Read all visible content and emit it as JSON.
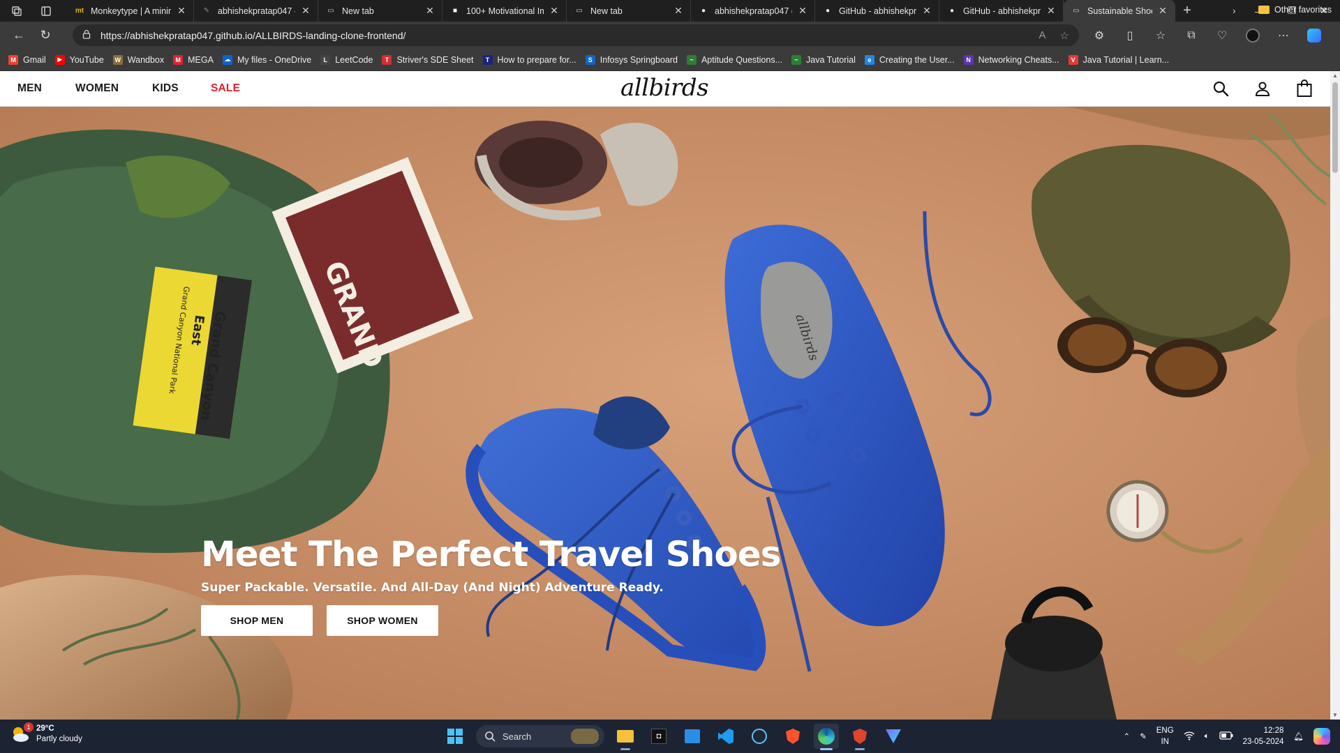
{
  "browser": {
    "tabs": [
      {
        "title": "Monkeytype | A minim",
        "favicon": "mt",
        "color": "#e2b714",
        "active": false
      },
      {
        "title": "abhishekpratap047 - ",
        "favicon": "leaf",
        "color": "#8a8a8a",
        "active": false
      },
      {
        "title": "New tab",
        "favicon": "page",
        "color": "#cccccc",
        "active": false
      },
      {
        "title": "100+ Motivational Im",
        "favicon": "square",
        "color": "#ffffff",
        "active": false
      },
      {
        "title": "New tab",
        "favicon": "page",
        "color": "#cccccc",
        "active": false
      },
      {
        "title": "abhishekpratap047 (A",
        "favicon": "github",
        "color": "#ffffff",
        "active": false
      },
      {
        "title": "GitHub - abhishekpra",
        "favicon": "github",
        "color": "#ffffff",
        "active": false
      },
      {
        "title": "GitHub - abhishekpra",
        "favicon": "github",
        "color": "#ffffff",
        "active": false
      },
      {
        "title": "Sustainable Shoes &",
        "favicon": "page",
        "color": "#cccccc",
        "active": true
      }
    ],
    "address": "https://abhishekpratap047.github.io/ALLBIRDS-landing-clone-frontend/",
    "bookmarks": [
      {
        "label": "Gmail",
        "icon": "gmail-icon",
        "color": "#ea4335",
        "glyph": "M"
      },
      {
        "label": "YouTube",
        "icon": "youtube-icon",
        "color": "#ff0000",
        "glyph": "▶"
      },
      {
        "label": "Wandbox",
        "icon": "wandbox-icon",
        "color": "#8a6d3b",
        "glyph": "W"
      },
      {
        "label": "MEGA",
        "icon": "mega-icon",
        "color": "#d9272e",
        "glyph": "M"
      },
      {
        "label": "My files - OneDrive",
        "icon": "onedrive-icon",
        "color": "#0a64d2",
        "glyph": "☁"
      },
      {
        "label": "LeetCode",
        "icon": "leetcode-icon",
        "color": "#444444",
        "glyph": "L"
      },
      {
        "label": "Striver's SDE Sheet",
        "icon": "tuf-icon",
        "color": "#d32f2f",
        "glyph": "T"
      },
      {
        "label": "How to prepare for...",
        "icon": "tnp-icon",
        "color": "#1a237e",
        "glyph": "T"
      },
      {
        "label": "Infosys Springboard",
        "icon": "infosys-icon",
        "color": "#1565c0",
        "glyph": "S"
      },
      {
        "label": "Aptitude Questions...",
        "icon": "aptitude-icon",
        "color": "#2e7d32",
        "glyph": "~"
      },
      {
        "label": "Java Tutorial",
        "icon": "java-icon",
        "color": "#2e7d32",
        "glyph": "~"
      },
      {
        "label": "Creating the User...",
        "icon": "edu-icon",
        "color": "#1e88e5",
        "glyph": "e"
      },
      {
        "label": "Networking Cheats...",
        "icon": "network-icon",
        "color": "#5e35b1",
        "glyph": "N"
      },
      {
        "label": "Java Tutorial | Learn...",
        "icon": "vk-icon",
        "color": "#e53935",
        "glyph": "V"
      }
    ],
    "other_favorites": "Other favorites"
  },
  "site": {
    "nav": {
      "men": "MEN",
      "women": "WOMEN",
      "kids": "KIDS",
      "sale": "SALE"
    },
    "logo": "allbirds",
    "hero": {
      "title": "Meet The Perfect Travel Shoes",
      "subtitle": "Super Packable. Versatile. And All-Day (And Night) Adventure Ready.",
      "shop_men": "SHOP MEN",
      "shop_women": "SHOP WOMEN",
      "image_book_text": [
        "Grand Canyon",
        "East",
        "Grand Canyon National Park"
      ],
      "image_magazine_text": "GRAND",
      "image_insole_text": "allbirds"
    },
    "colors": {
      "sale": "#e0202d",
      "accent": "#2f5fd0"
    }
  },
  "taskbar": {
    "weather_temp": "29°C",
    "weather_desc": "Partly cloudy",
    "weather_badge": "1",
    "search_placeholder": "Search",
    "lang_1": "ENG",
    "lang_2": "IN",
    "time": "12:28",
    "date": "23-05-2024"
  }
}
